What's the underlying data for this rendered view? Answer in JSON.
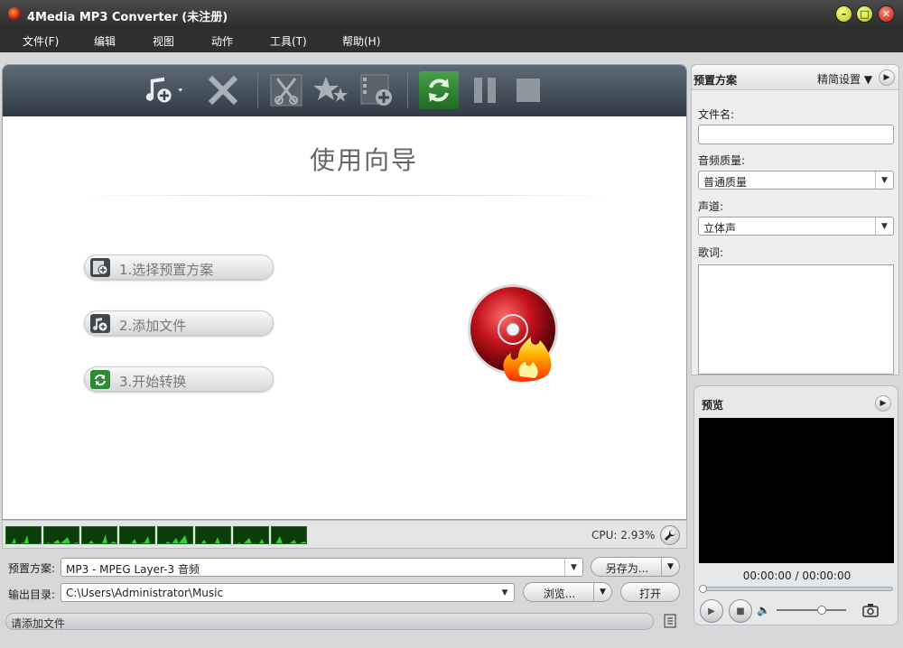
{
  "window": {
    "title": "4Media MP3 Converter (未注册)",
    "min": "–",
    "max": "□",
    "close": "✕"
  },
  "menu": [
    "文件(F)",
    "编辑",
    "视图",
    "动作",
    "工具(T)",
    "帮助(H)"
  ],
  "toolbar": {
    "buttons": [
      "add-music-icon",
      "delete-icon",
      "clip-icon",
      "effect-icon",
      "add-video-icon",
      "convert-icon",
      "pause-icon",
      "stop-icon"
    ]
  },
  "wizard": {
    "title": "使用向导",
    "steps": [
      "1.选择预置方案",
      "2.添加文件",
      "3.开始转换"
    ]
  },
  "status": {
    "cpu": "CPU: 2.93%",
    "message": "请添加文件"
  },
  "bottom": {
    "profile_label": "预置方案:",
    "profile_value": "MP3 - MPEG Layer-3 音频",
    "save_as": "另存为...",
    "output_label": "输出目录:",
    "output_value": "C:\\Users\\Administrator\\Music",
    "browse": "浏览...",
    "open": "打开"
  },
  "right": {
    "title": "预置方案",
    "advanced": "精简设置",
    "filename_label": "文件名:",
    "filename_value": "",
    "quality_label": "音频质量:",
    "quality_value": "普通质量",
    "channel_label": "声道:",
    "channel_value": "立体声",
    "lyrics_label": "歌词:"
  },
  "preview": {
    "title": "预览",
    "time": "00:00:00 / 00:00:00"
  },
  "colors": {
    "meter": "#0b3d0b",
    "meter_wave": "#2fd12f",
    "convert": "#2e8b34",
    "toolbar": "#3b4650"
  }
}
